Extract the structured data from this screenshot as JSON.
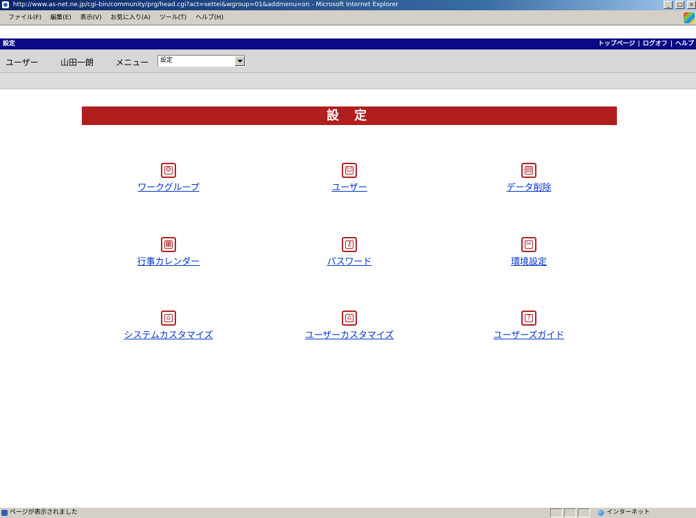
{
  "window": {
    "title": "http://www.as-net.ne.jp/cgi-bin/community/prg/head.cgi?act=settei&wgroup=01&addmenu=on - Microsoft Internet Explorer",
    "buttons": [
      "_",
      "□",
      "×"
    ]
  },
  "menubar": {
    "items": [
      "ファイル(F)",
      "編集(E)",
      "表示(V)",
      "お気に入り(A)",
      "ツール(T)",
      "ヘルプ(H)"
    ]
  },
  "appbar": {
    "title": "設定",
    "links": [
      "トップページ",
      "ログオフ",
      "ヘルプ"
    ],
    "separator": "|"
  },
  "userbar": {
    "user_label": "ユーザー",
    "user_name": "山田一朗",
    "menu_label": "メニュー",
    "menu_selected": "設定"
  },
  "banner": {
    "title": "設 定"
  },
  "settings": [
    {
      "label": "ワークグループ",
      "icon": "workgroup-icon"
    },
    {
      "label": "ユーザー",
      "icon": "user-icon"
    },
    {
      "label": "データ削除",
      "icon": "trash-icon"
    },
    {
      "label": "行事カレンダー",
      "icon": "calendar-icon"
    },
    {
      "label": "パスワード",
      "icon": "key-icon"
    },
    {
      "label": "環境設定",
      "icon": "tools-icon"
    },
    {
      "label": "システムカスタマイズ",
      "icon": "system-customize-icon"
    },
    {
      "label": "ユーザーカスタマイズ",
      "icon": "user-customize-icon"
    },
    {
      "label": "ユーザーズガイド",
      "icon": "guide-icon"
    }
  ],
  "status": {
    "text": "ページが表示されました",
    "zone": "インターネット"
  },
  "colors": {
    "banner": "#b11e1e",
    "appbar": "#0a0a84",
    "link": "#0033cc"
  }
}
